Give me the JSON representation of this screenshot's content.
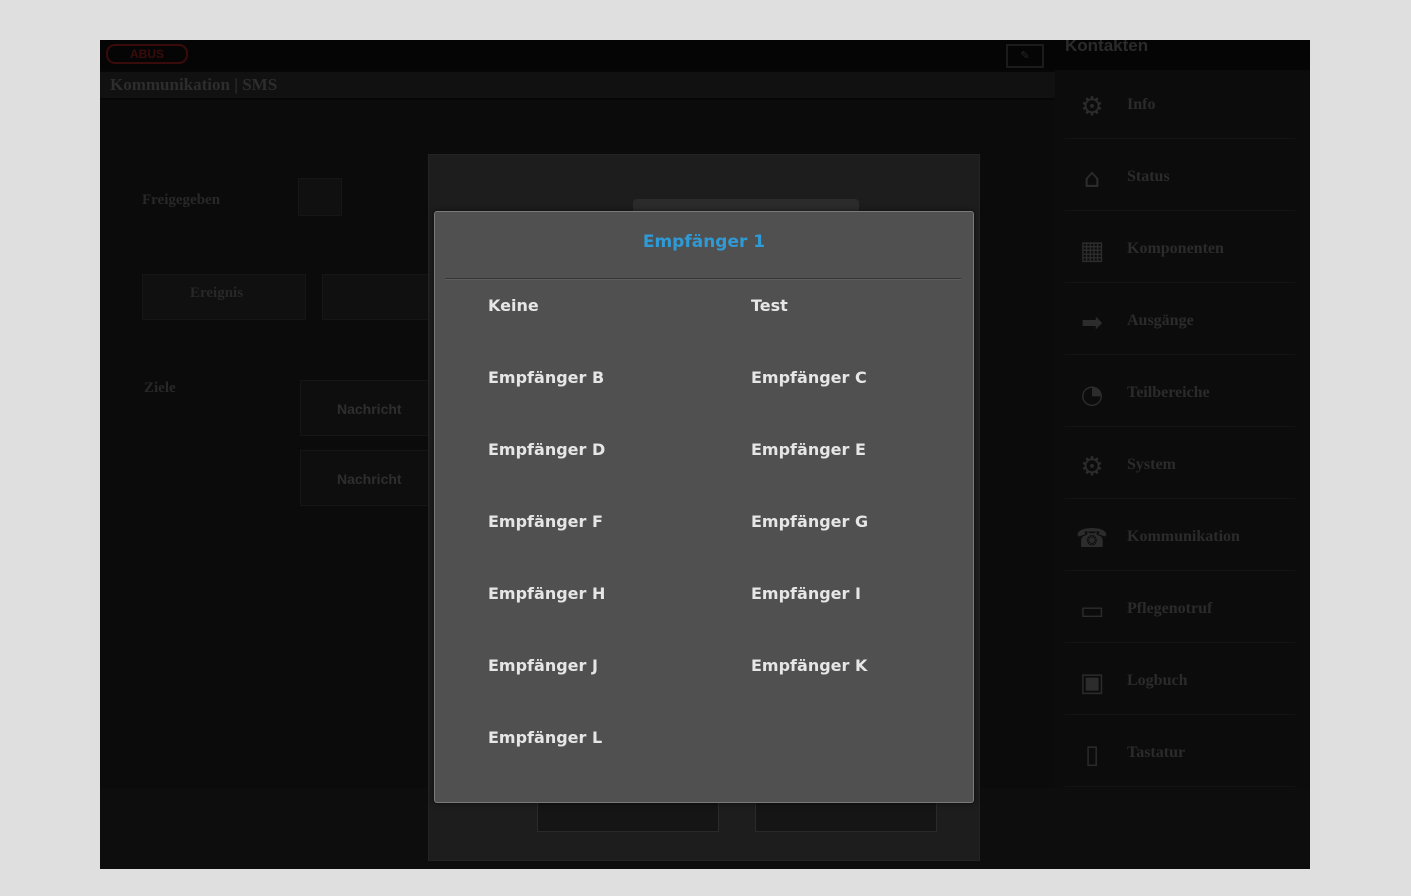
{
  "app": {
    "logo_text": "ABUS",
    "header_title": "Kontakten",
    "breadcrumb": "Kommunikation | SMS"
  },
  "background_form": {
    "enabled_label": "Freigegeben",
    "event_label": "Ereignis",
    "target_label": "Ziele",
    "message_label_1": "Nachricht",
    "message_label_2": "Nachricht"
  },
  "sidebar": {
    "items": [
      {
        "label": "Info",
        "icon": "gear-icon"
      },
      {
        "label": "Status",
        "icon": "home-icon"
      },
      {
        "label": "Komponenten",
        "icon": "component-icon"
      },
      {
        "label": "Ausgänge",
        "icon": "output-icon"
      },
      {
        "label": "Teilbereiche",
        "icon": "partition-icon"
      },
      {
        "label": "System",
        "icon": "gear-icon"
      },
      {
        "label": "Kommunikation",
        "icon": "phone-icon"
      },
      {
        "label": "Pflegenotruf",
        "icon": "bed-icon"
      },
      {
        "label": "Logbuch",
        "icon": "calendar-icon"
      },
      {
        "label": "Tastatur",
        "icon": "keypad-icon"
      }
    ]
  },
  "dialog": {
    "title": "Empfänger 1",
    "options": [
      "Keine",
      "Test",
      "Empfänger B",
      "Empfänger C",
      "Empfänger D",
      "Empfänger E",
      "Empfänger F",
      "Empfänger G",
      "Empfänger H",
      "Empfänger I",
      "Empfänger J",
      "Empfänger K",
      "Empfänger L"
    ]
  },
  "colors": {
    "accent": "#2e9ad6",
    "dialog_bg": "#505050",
    "page_bg": "#dfdfdf"
  }
}
